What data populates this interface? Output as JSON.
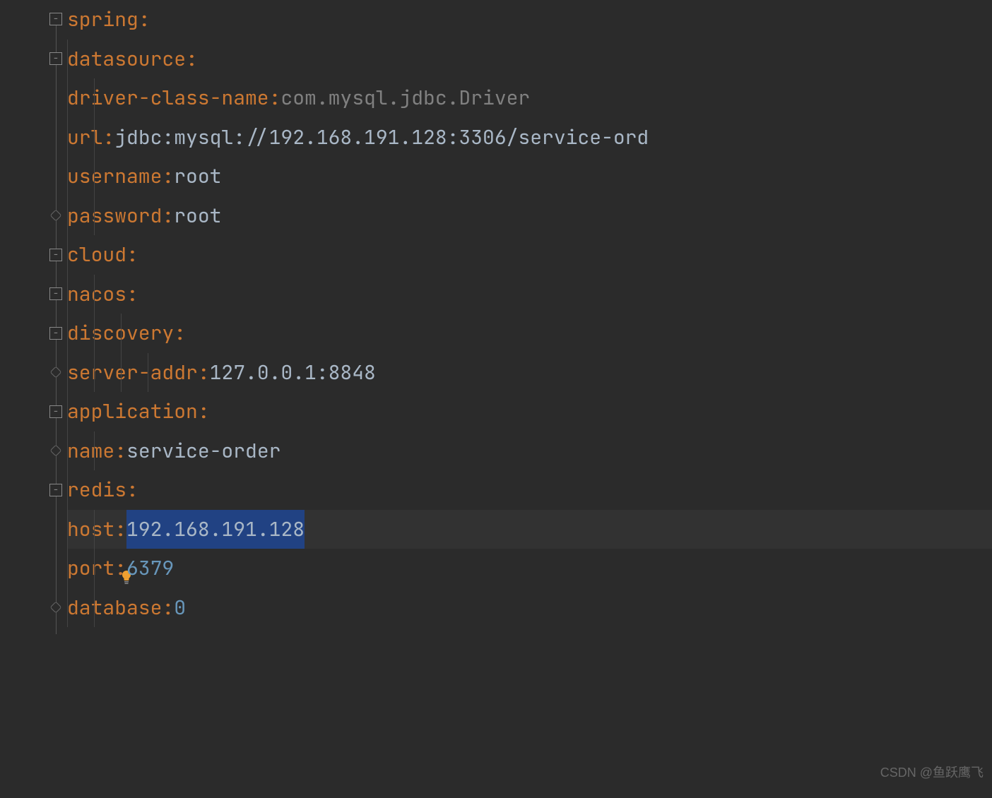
{
  "yaml": {
    "root_key": "spring",
    "datasource": {
      "key": "datasource",
      "driver_key": "driver-class-name",
      "driver_value": "com.mysql.jdbc.Driver",
      "url_key": "url",
      "url_value": "jdbc:mysql://192.168.191.128:3306/service-ord",
      "username_key": "username",
      "username_value": "root",
      "password_key": "password",
      "password_value": "root"
    },
    "cloud": {
      "key": "cloud",
      "nacos_key": "nacos",
      "discovery_key": "discovery",
      "server_addr_key": "server-addr",
      "server_addr_value": "127.0.0.1:8848"
    },
    "application": {
      "key": "application",
      "name_key": "name",
      "name_value": "service-order"
    },
    "redis": {
      "key": "redis",
      "host_key": "host",
      "host_value": "192.168.191.128",
      "port_key": "port",
      "port_value": "6379",
      "database_key": "database",
      "database_value": "0"
    }
  },
  "watermark": "CSDN @鱼跃鹰飞"
}
